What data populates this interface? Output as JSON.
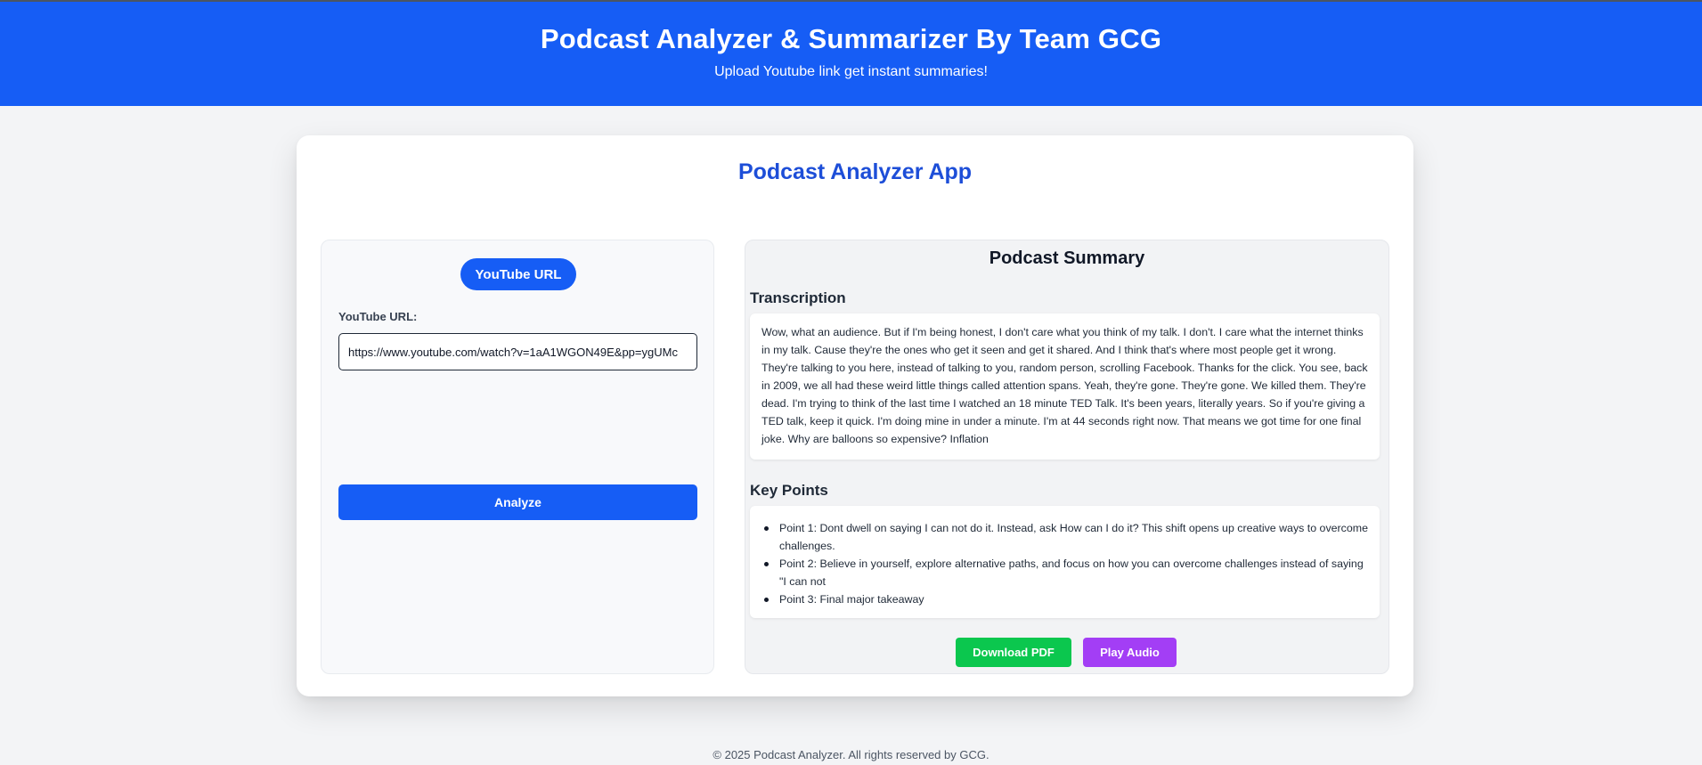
{
  "header": {
    "title": "Podcast Analyzer & Summarizer By Team GCG",
    "subtitle": "Upload Youtube link get instant summaries!"
  },
  "app": {
    "title": "Podcast Analyzer App"
  },
  "input_panel": {
    "tab_label": "YouTube URL",
    "field_label": "YouTube URL:",
    "url_value": "https://www.youtube.com/watch?v=1aA1WGON49E&pp=ygUMc",
    "analyze_label": "Analyze"
  },
  "summary_panel": {
    "title": "Podcast Summary",
    "transcription_heading": "Transcription",
    "transcription_text": "Wow, what an audience. But if I'm being honest, I don't care what you think of my talk. I don't. I care what the internet thinks in my talk. Cause they're the ones who get it seen and get it shared. And I think that's where most people get it wrong. They're talking to you here, instead of talking to you, random person, scrolling Facebook. Thanks for the click. You see, back in 2009, we all had these weird little things called attention spans. Yeah, they're gone. They're gone. We killed them. They're dead. I'm trying to think of the last time I watched an 18 minute TED Talk. It's been years, literally years. So if you're giving a TED talk, keep it quick. I'm doing mine in under a minute. I'm at 44 seconds right now. That means we got time for one final joke. Why are balloons so expensive? Inflation",
    "key_points_heading": "Key Points",
    "key_points": [
      "Point 1: Dont dwell on saying I can not do it. Instead, ask How can I do it? This shift opens up creative ways to overcome challenges.",
      "Point 2: Believe in yourself, explore alternative paths, and focus on how you can overcome challenges instead of saying \"I can not",
      "Point 3: Final major takeaway"
    ],
    "download_pdf_label": "Download PDF",
    "play_audio_label": "Play Audio"
  },
  "footer": {
    "text": "© 2025 Podcast Analyzer. All rights reserved by GCG."
  },
  "colors": {
    "brand_blue": "#165df5",
    "title_blue": "#1d4ed8",
    "pdf_green": "#0bc74e",
    "audio_purple": "#a33ef5",
    "page_bg": "#f3f4f6"
  }
}
